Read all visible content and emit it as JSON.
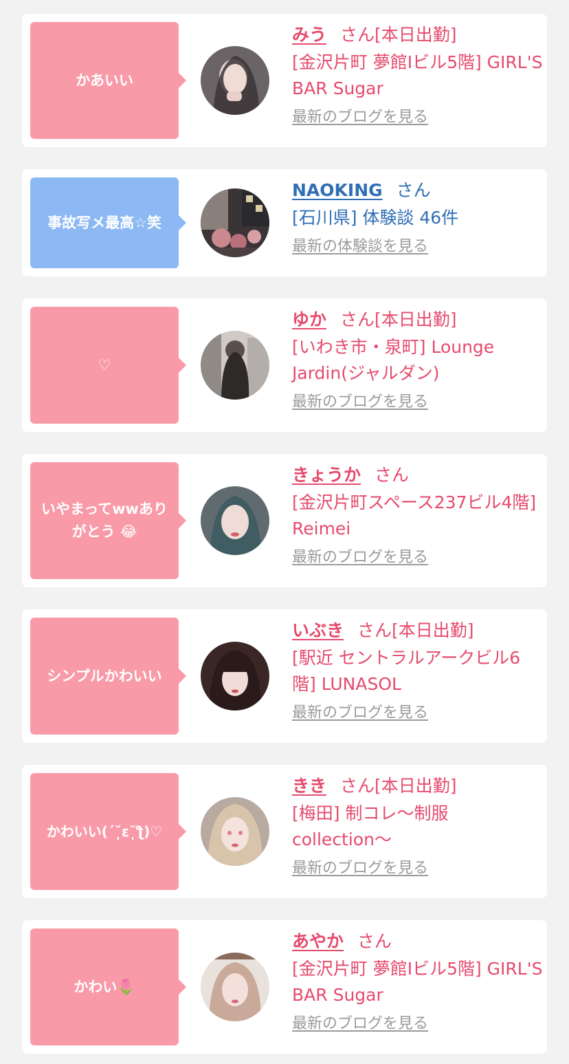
{
  "cards": [
    {
      "comment": "かあいい",
      "name": "みう",
      "suffix": "さん[本日出勤]",
      "shop": "[金沢片町 夢館Ⅰビル5階] GIRL'S BAR Sugar",
      "link": "最新のブログを見る",
      "bubble_color": "#f99aa8",
      "text_color": "#e64a6c",
      "avatar": "woman-portrait-dark-hair"
    },
    {
      "comment": "事故写メ最高☆笑",
      "name": "NAOKING",
      "suffix": "さん",
      "shop": "[石川県] 体験談 46件",
      "link": "最新の体験談を見る",
      "bubble_color": "#8cb8f3",
      "text_color": "#2f6eb5",
      "avatar": "city-street-photo"
    },
    {
      "comment": "♡",
      "name": "ゆか",
      "suffix": "さん[本日出勤]",
      "shop": "[いわき市・泉町] Lounge Jardin(ジャルダン)",
      "link": "最新のブログを見る",
      "bubble_color": "#f99aa8",
      "text_color": "#e64a6c",
      "avatar": "woman-back-view"
    },
    {
      "comment": "いやまってwwありがとう 😂",
      "name": "きょうか",
      "suffix": "さん",
      "shop": "[金沢片町スペース237ビル4階] Reimei",
      "link": "最新のブログを見る",
      "bubble_color": "#f99aa8",
      "text_color": "#e64a6c",
      "avatar": "woman-portrait-teal-hair"
    },
    {
      "comment": "シンプルかわいい",
      "name": "いぶき",
      "suffix": "さん[本日出勤]",
      "shop": "[駅近 セントラルアークビル6階] LUNASOL",
      "link": "最新のブログを見る",
      "bubble_color": "#f99aa8",
      "text_color": "#e64a6c",
      "avatar": "woman-portrait-bangs"
    },
    {
      "comment": "かわいい(´˘̩̩̩ε˘̩ƪ)♡",
      "name": "きき",
      "suffix": "さん[本日出勤]",
      "shop": "[梅田] 制コレ〜制服collection〜",
      "link": "最新のブログを見る",
      "bubble_color": "#f99aa8",
      "text_color": "#e64a6c",
      "avatar": "woman-portrait-blonde"
    },
    {
      "comment": "かわい🌷",
      "name": "あやか",
      "suffix": "さん",
      "shop": "[金沢片町 夢館Ⅰビル5階] GIRL'S BAR Sugar",
      "link": "最新のブログを見る",
      "bubble_color": "#f99aa8",
      "text_color": "#e64a6c",
      "avatar": "woman-portrait-light-hair"
    }
  ]
}
